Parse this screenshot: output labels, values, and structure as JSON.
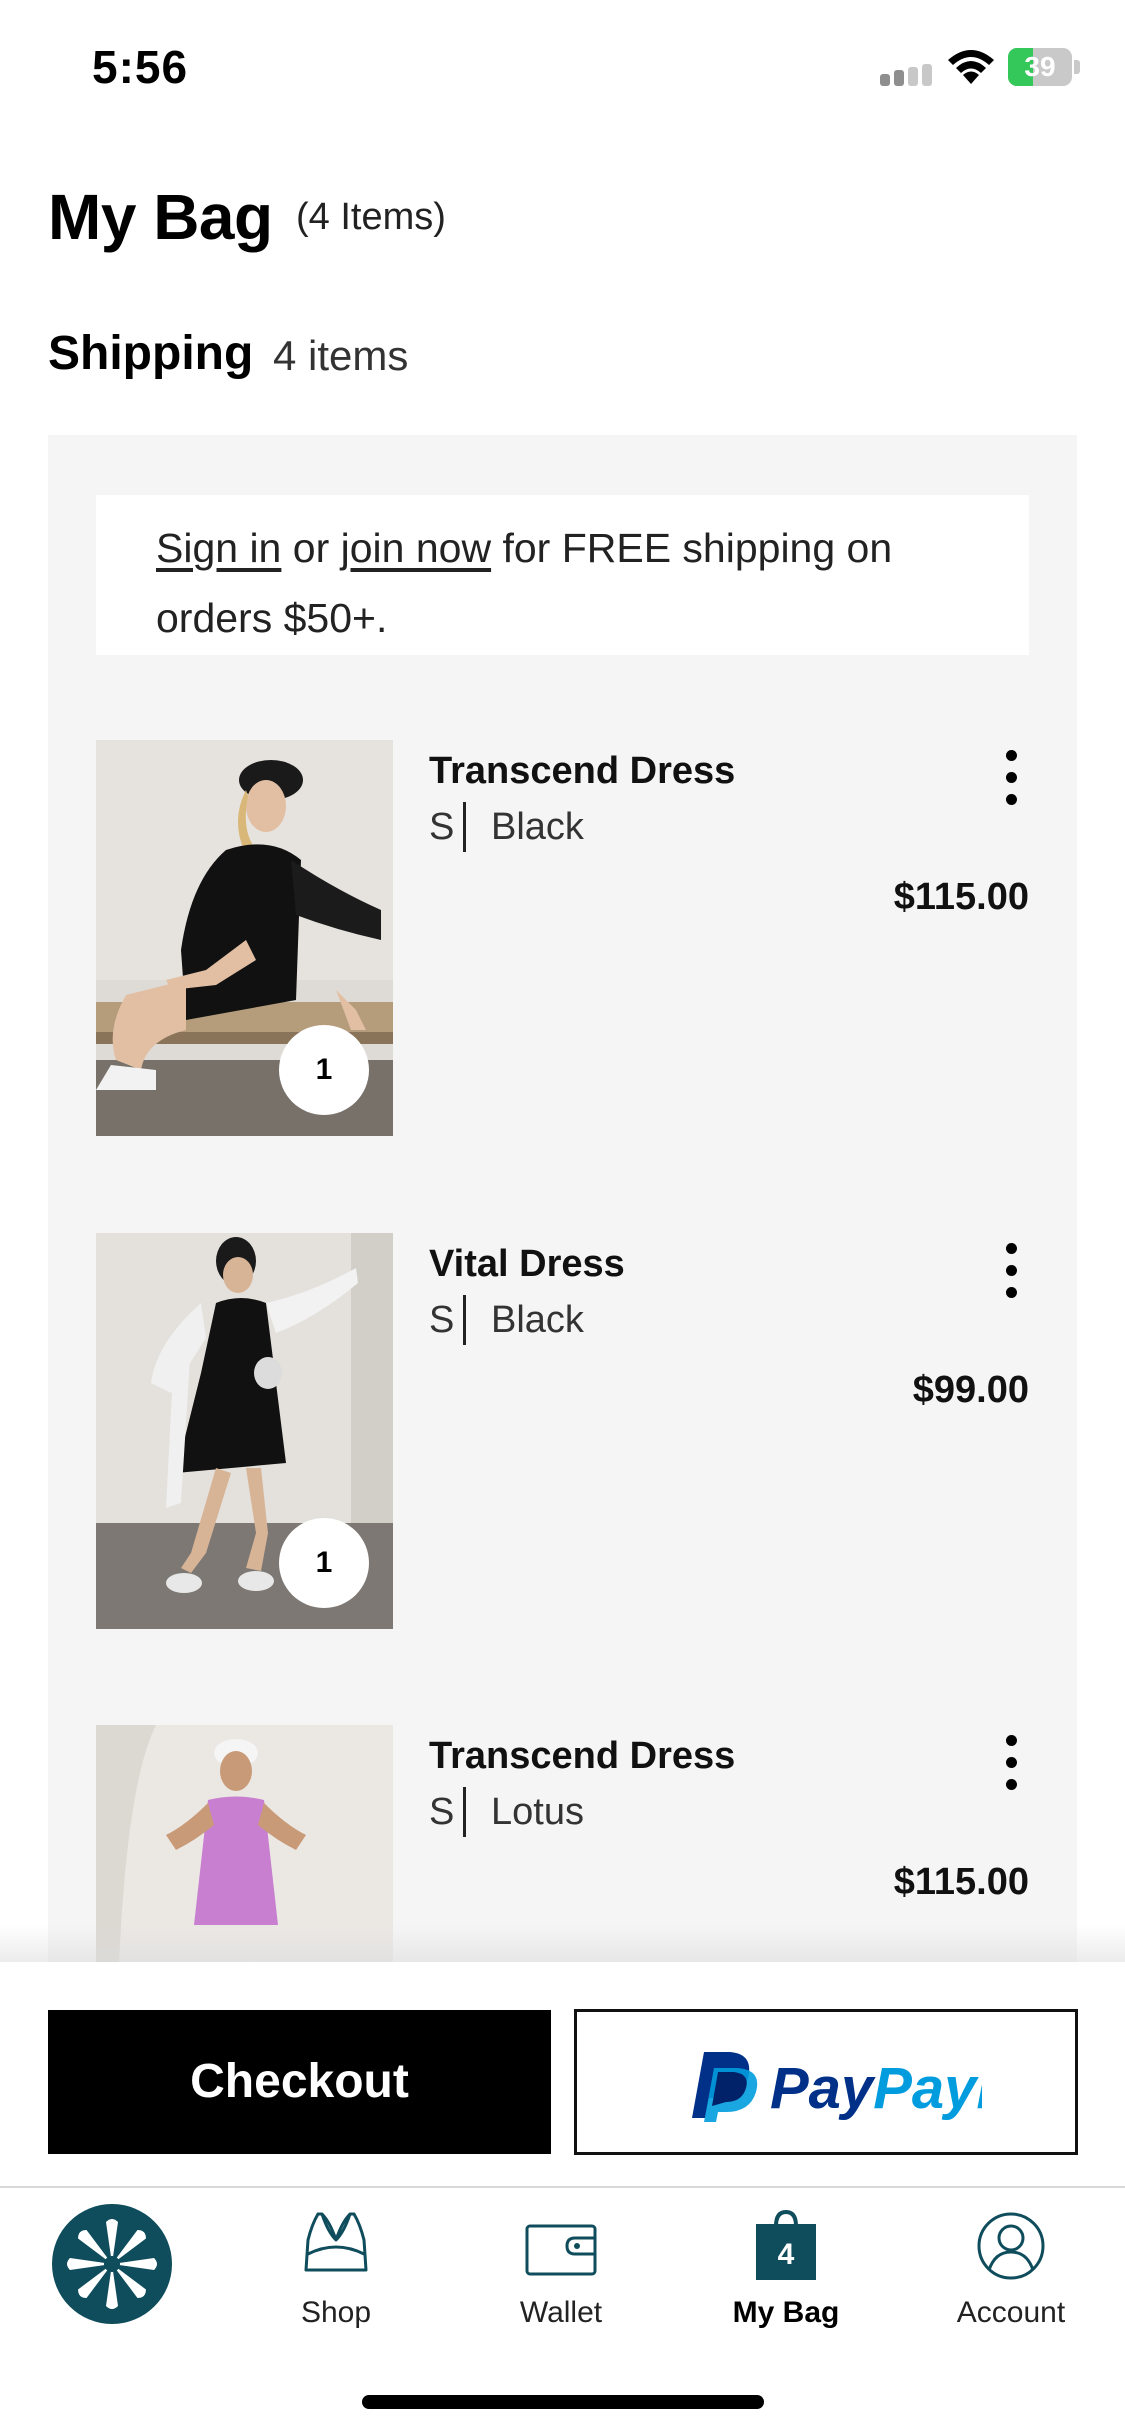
{
  "status_bar": {
    "time": "5:56",
    "battery": "39",
    "battery_level": 0.39
  },
  "header": {
    "title": "My Bag",
    "count": "(4 Items)"
  },
  "section": {
    "title": "Shipping",
    "count": "4 items"
  },
  "promo": {
    "sign_in": "Sign in",
    "or": " or ",
    "join_now": "join now",
    "rest": " for FREE shipping on orders $50+."
  },
  "items": [
    {
      "name": "Transcend Dress",
      "size": "S",
      "color": "Black",
      "price": "$115.00",
      "quantity": "1"
    },
    {
      "name": "Vital Dress",
      "size": "S",
      "color": "Black",
      "price": "$99.00",
      "quantity": "1"
    },
    {
      "name": "Transcend Dress",
      "size": "S",
      "color": "Lotus",
      "price": "$115.00"
    }
  ],
  "actions": {
    "checkout": "Checkout",
    "paypal": "PayPal"
  },
  "tabs": [
    {
      "label": "",
      "icon": "brand-logo-icon"
    },
    {
      "label": "Shop",
      "icon": "bra-icon"
    },
    {
      "label": "Wallet",
      "icon": "wallet-icon"
    },
    {
      "label": "My Bag",
      "icon": "bag-icon",
      "badge": "4"
    },
    {
      "label": "Account",
      "icon": "account-icon"
    }
  ],
  "colors": {
    "brand": "#0f4c5c",
    "paypal_dark": "#003087",
    "paypal_light": "#009cde",
    "battery": "#34c759"
  }
}
